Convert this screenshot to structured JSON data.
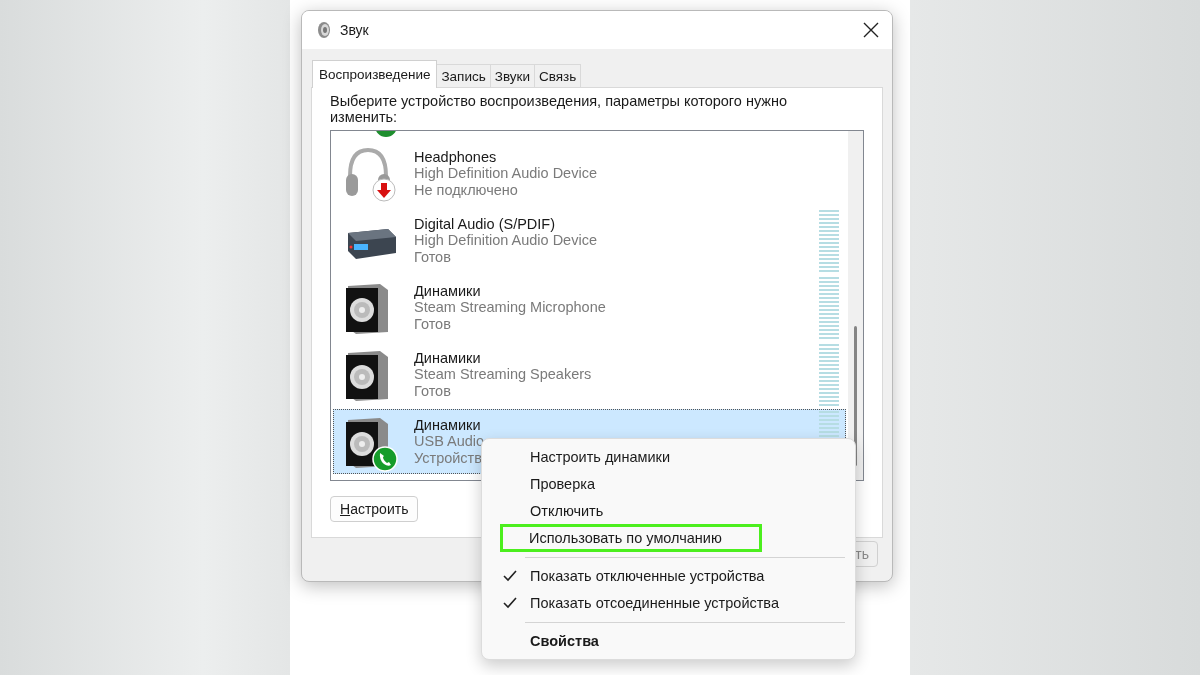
{
  "window": {
    "title": "Звук"
  },
  "tabs": [
    {
      "label": "Воспроизведение",
      "selected": true
    },
    {
      "label": "Запись",
      "selected": false
    },
    {
      "label": "Звуки",
      "selected": false
    },
    {
      "label": "Связь",
      "selected": false
    }
  ],
  "prompt": "Выберите устройство воспроизведения, параметры которого нужно изменить:",
  "devices": [
    {
      "name": "Headphones",
      "driver": "High Definition Audio Device",
      "status": "Не подключено",
      "kind": "headphones",
      "disconnected": true,
      "default_communication": false,
      "meter": false,
      "selected": false
    },
    {
      "name": "Digital Audio (S/PDIF)",
      "driver": "High Definition Audio Device",
      "status": "Готов",
      "kind": "receiver",
      "disconnected": false,
      "default_communication": false,
      "meter": true,
      "selected": false
    },
    {
      "name": "Динамики",
      "driver": "Steam Streaming Microphone",
      "status": "Готов",
      "kind": "speaker",
      "disconnected": false,
      "default_communication": false,
      "meter": true,
      "selected": false
    },
    {
      "name": "Динамики",
      "driver": "Steam Streaming Speakers",
      "status": "Готов",
      "kind": "speaker",
      "disconnected": false,
      "default_communication": false,
      "meter": true,
      "selected": false
    },
    {
      "name": "Динамики",
      "driver": "USB Audio",
      "status": "Устройств",
      "kind": "speaker",
      "disconnected": false,
      "default_communication": true,
      "meter": true,
      "selected": true
    }
  ],
  "buttons": [
    {
      "label": "Настроить"
    }
  ],
  "footer_button_fragment": "ть",
  "context_menu": [
    {
      "kind": "item",
      "label": "Настроить динамики",
      "checked": false,
      "highlighted": false,
      "bold": false
    },
    {
      "kind": "item",
      "label": "Проверка",
      "checked": false,
      "highlighted": false,
      "bold": false
    },
    {
      "kind": "item",
      "label": "Отключить",
      "checked": false,
      "highlighted": false,
      "bold": false
    },
    {
      "kind": "item",
      "label": "Использовать по умолчанию",
      "checked": false,
      "highlighted": true,
      "bold": false
    },
    {
      "kind": "separator"
    },
    {
      "kind": "item",
      "label": "Показать отключенные устройства",
      "checked": true,
      "highlighted": false,
      "bold": false
    },
    {
      "kind": "item",
      "label": "Показать отсоединенные устройства",
      "checked": true,
      "highlighted": false,
      "bold": false
    },
    {
      "kind": "separator"
    },
    {
      "kind": "item",
      "label": "Свойства",
      "checked": false,
      "highlighted": false,
      "bold": true
    }
  ]
}
